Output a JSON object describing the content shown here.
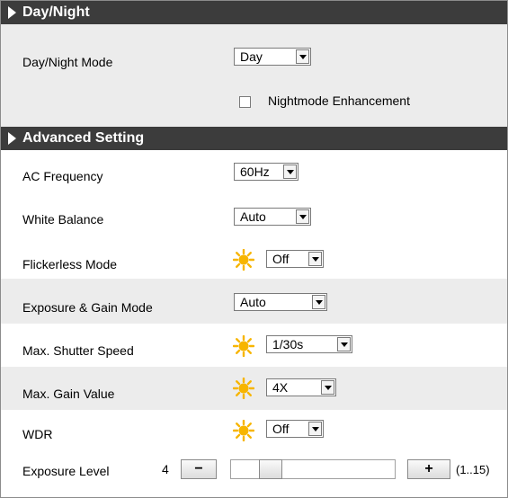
{
  "day_night": {
    "header": "Day/Night",
    "mode_label": "Day/Night Mode",
    "mode_value": "Day",
    "enhancement_label": "Nightmode Enhancement",
    "enhancement_checked": false
  },
  "advanced": {
    "header": "Advanced Setting",
    "ac_frequency": {
      "label": "AC Frequency",
      "value": "60Hz"
    },
    "white_balance": {
      "label": "White Balance",
      "value": "Auto"
    },
    "flickerless": {
      "label": "Flickerless Mode",
      "value": "Off",
      "icon": "sun-icon"
    },
    "exposure_gain_mode": {
      "label": "Exposure & Gain Mode",
      "value": "Auto"
    },
    "max_shutter": {
      "label": "Max. Shutter Speed",
      "value": "1/30s",
      "icon": "sun-icon"
    },
    "max_gain": {
      "label": "Max. Gain Value",
      "value": "4X",
      "icon": "sun-icon"
    },
    "wdr": {
      "label": "WDR",
      "value": "Off",
      "icon": "sun-icon"
    },
    "exposure_level": {
      "label": "Exposure Level",
      "value": "4",
      "minus": "−",
      "plus": "+",
      "range": "(1..15)",
      "slider_fraction": 0.2
    }
  },
  "colors": {
    "header_bg": "#3c3c3c",
    "row_alt": "#ececec",
    "sun": "#f7b500"
  }
}
